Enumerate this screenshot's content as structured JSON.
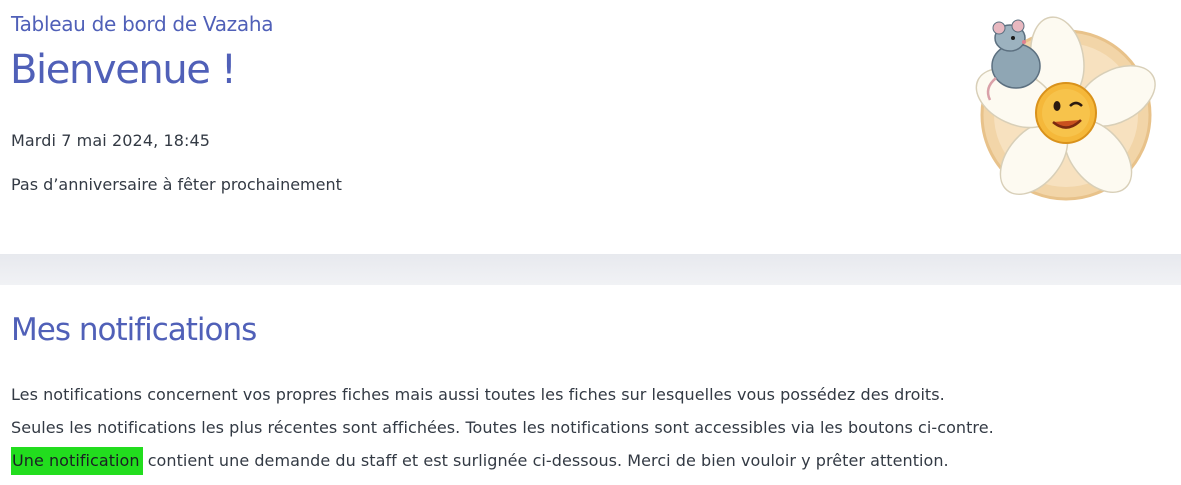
{
  "header": {
    "dashboard_title": "Tableau de bord de Vazaha",
    "welcome": "Bienvenue !",
    "date": "Mardi 7 mai 2024, 18:45",
    "birthday": "Pas d’anniversaire à fêter prochainement",
    "mascot_icon": "flower-sun-rat-mascot-icon"
  },
  "notifications": {
    "title": "Mes notifications",
    "line1": "Les notifications concernent vos propres fiches mais aussi toutes les fiches sur lesquelles vous possédez des droits.",
    "line2": "Seules les notifications les plus récentes sont affichées. Toutes les notifications sont accessibles via les boutons ci-contre.",
    "line3_highlight": "Une notification",
    "line3_rest": " contient une demande du staff et est surlignée ci-dessous. Merci de bien vouloir y prêter attention.",
    "highlight_color": "#22dd1e"
  },
  "colors": {
    "accent": "#5060b8",
    "text": "#333a44"
  }
}
